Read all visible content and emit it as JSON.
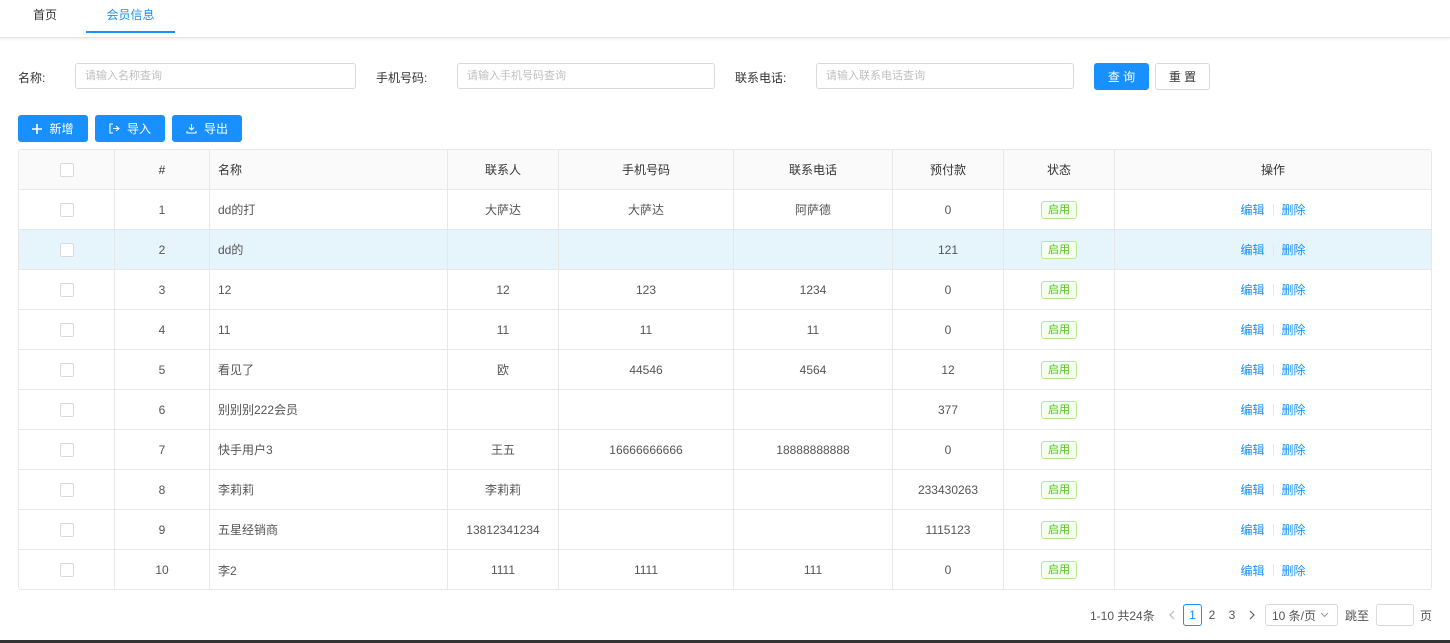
{
  "tabs": [
    {
      "label": "首页",
      "active": false
    },
    {
      "label": "会员信息",
      "active": true
    }
  ],
  "filters": {
    "name_label": "名称:",
    "name_placeholder": "请输入名称查询",
    "mobile_label": "手机号码:",
    "mobile_placeholder": "请输入手机号码查询",
    "phone_label": "联系电话:",
    "phone_placeholder": "请输入联系电话查询",
    "query_label": "查 询",
    "reset_label": "重 置"
  },
  "toolbar": {
    "add_label": "新增",
    "import_label": "导入",
    "export_label": "导出"
  },
  "table": {
    "headers": {
      "index": "#",
      "name": "名称",
      "contact": "联系人",
      "mobile": "手机号码",
      "phone": "联系电话",
      "prepay": "预付款",
      "status": "状态",
      "ops": "操作"
    },
    "edit_label": "编辑",
    "delete_label": "删除",
    "rows": [
      {
        "index": "1",
        "name": "dd的打",
        "contact": "大萨达",
        "mobile": "大萨达",
        "phone": "阿萨德",
        "prepay": "0",
        "status": "启用"
      },
      {
        "index": "2",
        "name": "dd的",
        "contact": "",
        "mobile": "",
        "phone": "",
        "prepay": "121",
        "status": "启用"
      },
      {
        "index": "3",
        "name": "12",
        "contact": "12",
        "mobile": "123",
        "phone": "1234",
        "prepay": "0",
        "status": "启用"
      },
      {
        "index": "4",
        "name": "11",
        "contact": "11",
        "mobile": "11",
        "phone": "11",
        "prepay": "0",
        "status": "启用"
      },
      {
        "index": "5",
        "name": "看见了",
        "contact": "欧",
        "mobile": "44546",
        "phone": "4564",
        "prepay": "12",
        "status": "启用"
      },
      {
        "index": "6",
        "name": "别别别222会员",
        "contact": "",
        "mobile": "",
        "phone": "",
        "prepay": "377",
        "status": "启用"
      },
      {
        "index": "7",
        "name": "快手用户3",
        "contact": "王五",
        "mobile": "16666666666",
        "phone": "18888888888",
        "prepay": "0",
        "status": "启用"
      },
      {
        "index": "8",
        "name": "李莉莉",
        "contact": "李莉莉",
        "mobile": "",
        "phone": "",
        "prepay": "233430263",
        "status": "启用"
      },
      {
        "index": "9",
        "name": "五星经销商",
        "contact": "13812341234",
        "mobile": "",
        "phone": "",
        "prepay": "1115123",
        "status": "启用"
      },
      {
        "index": "10",
        "name": "李2",
        "contact": "1111",
        "mobile": "1111",
        "phone": "111",
        "prepay": "0",
        "status": "启用"
      }
    ]
  },
  "pagination": {
    "total_text": "1-10 共24条",
    "pages": [
      "1",
      "2",
      "3"
    ],
    "current_page": "1",
    "page_size": "10 条/页",
    "jump_label": "跳至",
    "page_suffix": "页"
  },
  "colors": {
    "accent": "#1890ff",
    "status_green": "#52c41a",
    "highlight_row": "#e6f4fc"
  }
}
